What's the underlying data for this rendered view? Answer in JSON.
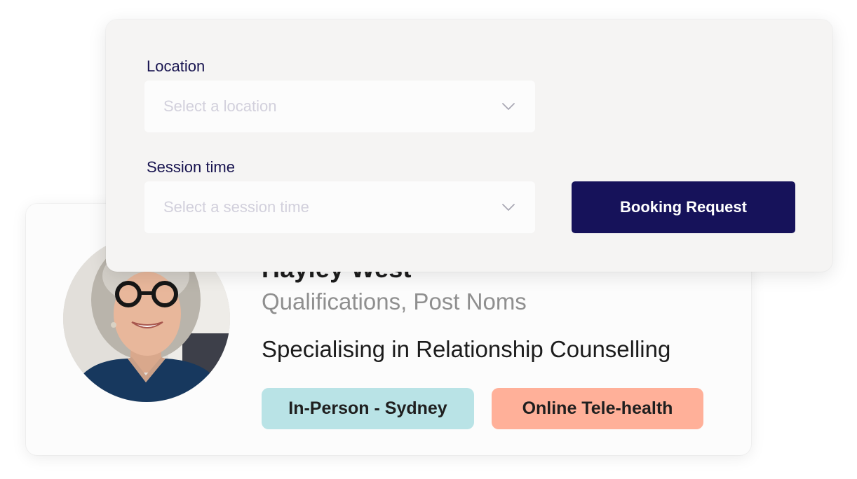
{
  "profile": {
    "name": "Hayley West",
    "qualifications": "Qualifications, Post Noms",
    "speciality": "Specialising in Relationship Counselling",
    "tags": [
      {
        "label": "In-Person - Sydney",
        "color": "#b9e3e6"
      },
      {
        "label": "Online Tele-health",
        "color": "#ffb099"
      }
    ]
  },
  "booking_form": {
    "location": {
      "label": "Location",
      "placeholder": "Select a location",
      "icon": "chevron-down-icon"
    },
    "session_time": {
      "label": "Session time",
      "placeholder": "Select a session time",
      "icon": "chevron-down-icon"
    },
    "submit_label": "Booking Request"
  },
  "colors": {
    "primary": "#16125a",
    "label_text": "#17134f",
    "panel_background": "#f5f4f3",
    "placeholder_text": "#d2d0dc"
  }
}
